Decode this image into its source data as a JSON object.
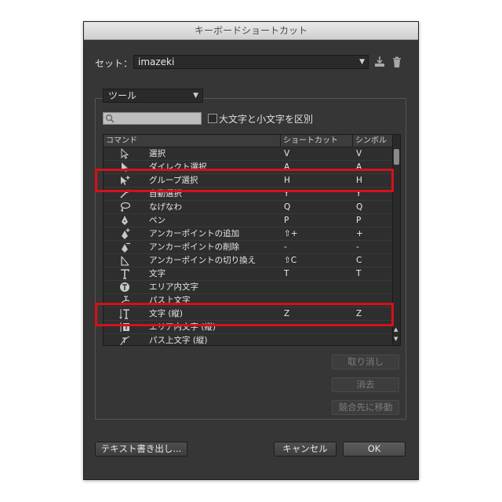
{
  "dialog": {
    "title": "キーボードショートカット"
  },
  "set": {
    "label": "セット：",
    "value": "imazeki"
  },
  "tool_menu": {
    "value": "ツール"
  },
  "search": {
    "placeholder": ""
  },
  "case_option": {
    "label": "大文字と小文字を区別",
    "checked": false
  },
  "table": {
    "headers": {
      "command": "コマンド",
      "shortcut": "ショートカット",
      "symbol": "シンボル"
    },
    "rows": [
      {
        "icon": "selection-arrow-icon",
        "command": "選択",
        "shortcut": "V",
        "symbol": "V"
      },
      {
        "icon": "direct-selection-icon",
        "command": "ダイレクト選択",
        "shortcut": "A",
        "symbol": "A"
      },
      {
        "icon": "group-selection-icon",
        "command": "グループ選択",
        "shortcut": "H",
        "symbol": "H"
      },
      {
        "icon": "auto-select-icon",
        "command": "自動選択",
        "shortcut": "Y",
        "symbol": "Y"
      },
      {
        "icon": "lasso-icon",
        "command": "なげなわ",
        "shortcut": "Q",
        "symbol": "Q"
      },
      {
        "icon": "pen-icon",
        "command": "ペン",
        "shortcut": "P",
        "symbol": "P"
      },
      {
        "icon": "add-anchor-point-icon",
        "command": "アンカーポイントの追加",
        "shortcut": "⇧+",
        "symbol": "+"
      },
      {
        "icon": "delete-anchor-point-icon",
        "command": "アンカーポイントの削除",
        "shortcut": "-",
        "symbol": "-"
      },
      {
        "icon": "convert-anchor-point-icon",
        "command": "アンカーポイントの切り換え",
        "shortcut": "⇧C",
        "symbol": "C"
      },
      {
        "icon": "type-icon",
        "command": "文字",
        "shortcut": "T",
        "symbol": "T"
      },
      {
        "icon": "area-type-icon",
        "command": "エリア内文字",
        "shortcut": "",
        "symbol": ""
      },
      {
        "icon": "type-on-path-icon",
        "command": "パス上文字",
        "shortcut": "",
        "symbol": ""
      },
      {
        "icon": "vertical-type-icon",
        "command": "文字 (縦)",
        "shortcut": "Z",
        "symbol": "Z"
      },
      {
        "icon": "vertical-area-type-icon",
        "command": "エリア内文字 (縦)",
        "shortcut": "",
        "symbol": ""
      },
      {
        "icon": "vertical-type-on-path-icon",
        "command": "パス上文字 (縦)",
        "shortcut": "",
        "symbol": ""
      }
    ]
  },
  "side_buttons": {
    "undo": "取り消し",
    "clear": "消去",
    "go_to_conflict": "競合先に移動"
  },
  "footer": {
    "export_text": "テキスト書き出し...",
    "cancel": "キャンセル",
    "ok": "OK"
  },
  "colors": {
    "dialog_bg": "#363636",
    "highlight": "#d6111a"
  }
}
